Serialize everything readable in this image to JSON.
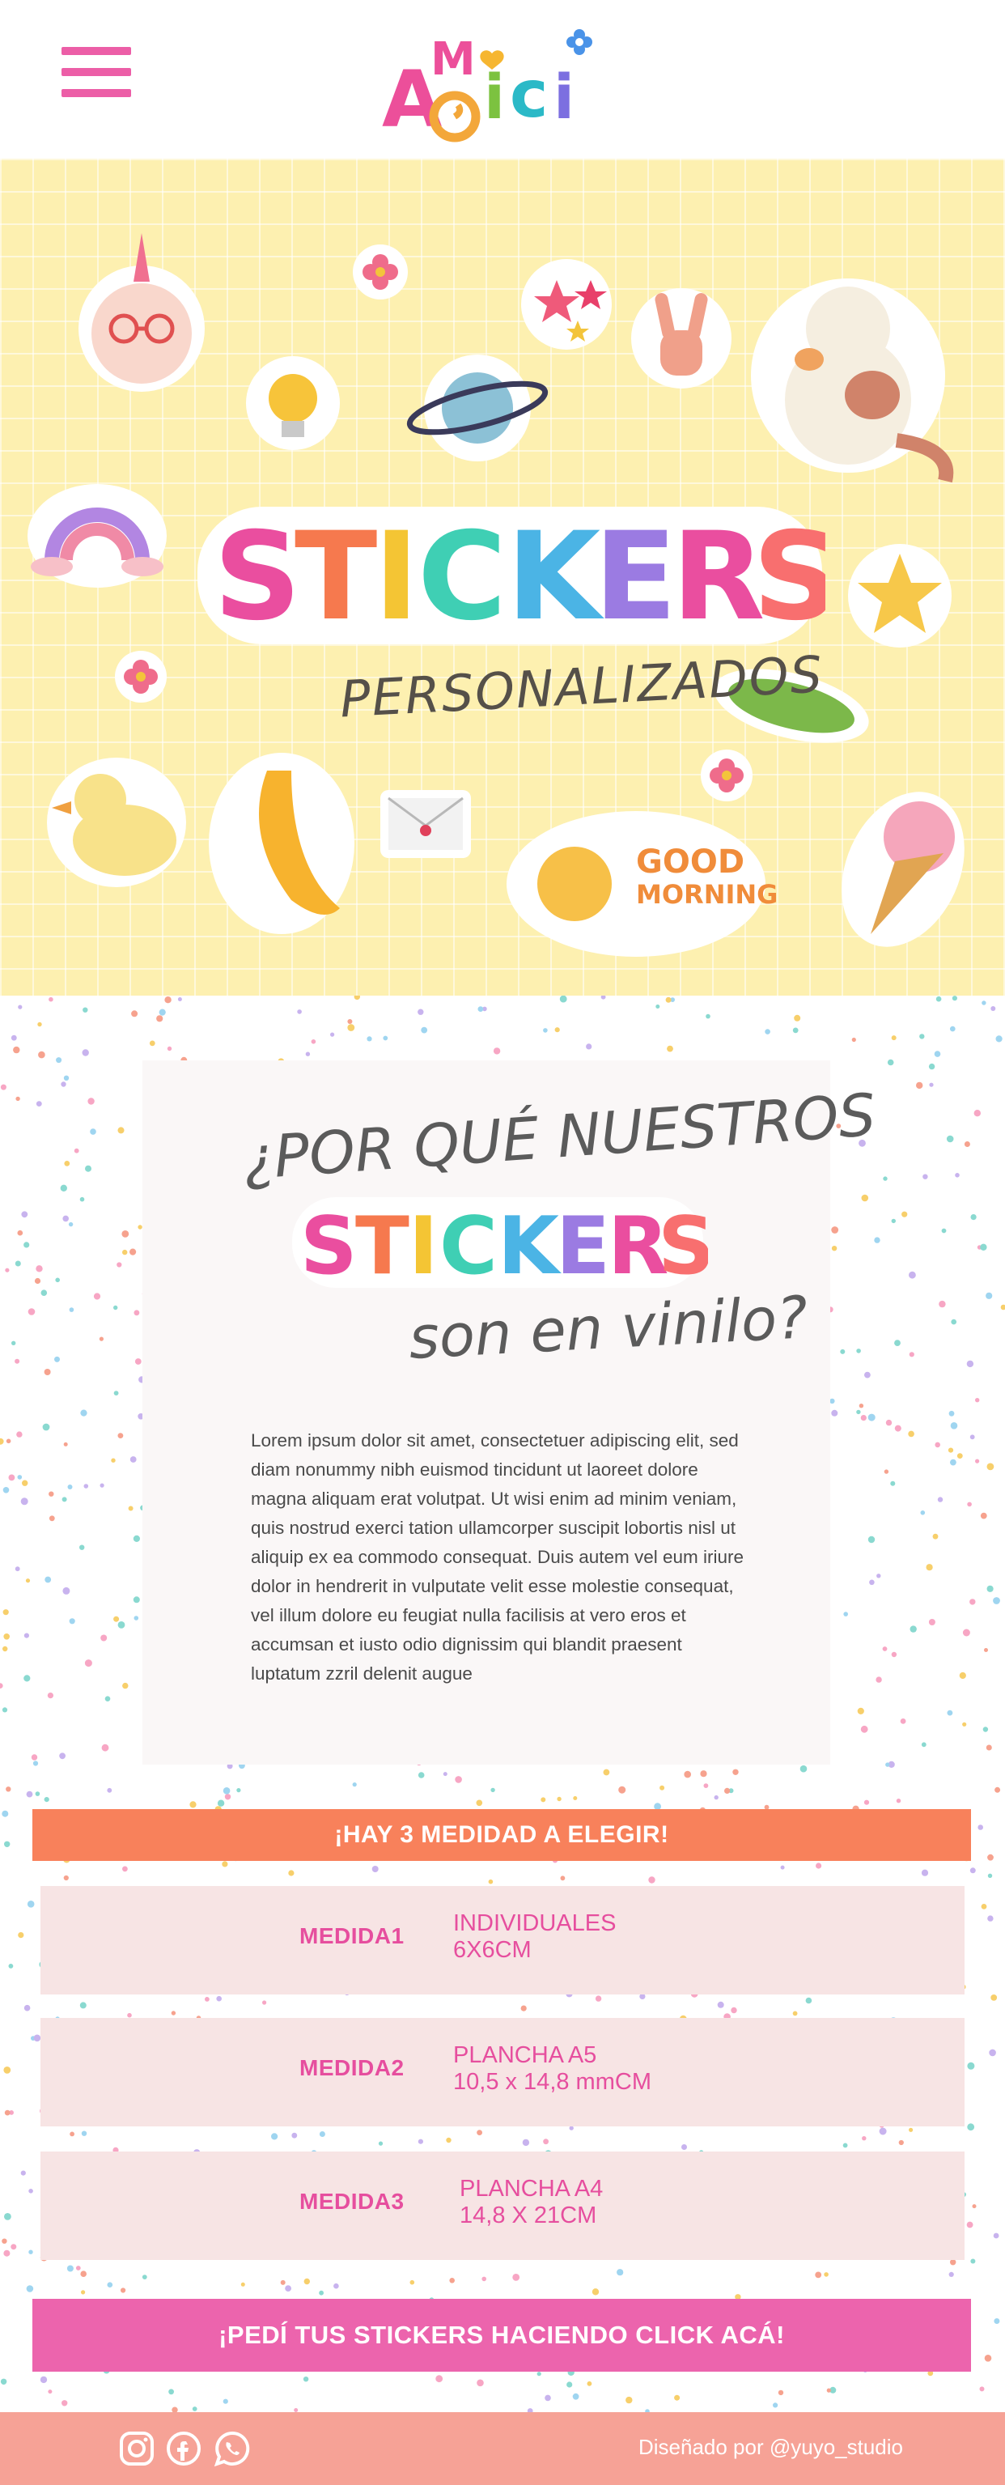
{
  "header": {
    "logo_text": "AMICI"
  },
  "hero": {
    "title": "STICKERS",
    "subtitle": "PERSONALIZADOS",
    "good_morning_1": "GOOD",
    "good_morning_2": "MORNING"
  },
  "why": {
    "line1": "¿POR QUÉ NUESTROS",
    "line2": "STICKERS",
    "line3": "son en vinilo?",
    "body": "Lorem ipsum dolor sit amet, consectetuer adipiscing elit, sed diam nonummy nibh euismod tincidunt ut laoreet dolore magna aliquam erat volutpat. Ut wisi enim ad minim veniam, quis nostrud exerci tation ullamcorper suscipit lobortis nisl ut aliquip ex ea commodo consequat. Duis autem vel eum iriure dolor in hendrerit in vulputate velit esse molestie consequat, vel illum dolore eu feugiat nulla facilisis at vero eros et accumsan et iusto odio dignissim qui blandit praesent luptatum zzril delenit augue"
  },
  "sizes": {
    "heading": "¡HAY 3 MEDIDAD A ELEGIR!",
    "items": [
      {
        "label": "MEDIDA1",
        "line1": "INDIVIDUALES",
        "line2": "6X6CM"
      },
      {
        "label": "MEDIDA2",
        "line1": "PLANCHA A5",
        "line2": "10,5 x 14,8 mmCM"
      },
      {
        "label": "MEDIDA3",
        "line1": "PLANCHA A4",
        "line2": "14,8 X 21CM"
      }
    ]
  },
  "cta": {
    "label": "¡PEDÍ TUS STICKERS HACIENDO CLICK ACÁ!"
  },
  "footer": {
    "credit": "Diseñado por @yuyo_studio",
    "icons": [
      "instagram-icon",
      "facebook-icon",
      "whatsapp-icon"
    ]
  },
  "colors": {
    "pink": "#ec5ea7",
    "orange": "#f8815b",
    "yellow_bg": "#fdf0b0",
    "measure_bg": "#f7e4e4",
    "footer": "#f6a296"
  }
}
